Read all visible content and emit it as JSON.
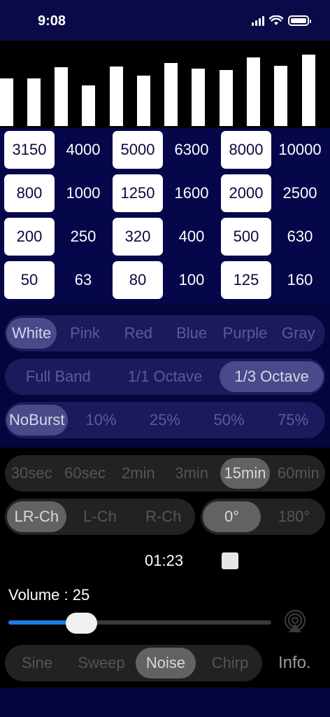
{
  "status_bar": {
    "time": "9:08"
  },
  "spectrum": {
    "levels": [
      0.57,
      0.57,
      0.7,
      0.48,
      0.71,
      0.6,
      0.75,
      0.68,
      0.67,
      0.82,
      0.72,
      0.85
    ]
  },
  "frequency_rows": [
    [
      {
        "label": "3150",
        "selected": true
      },
      {
        "label": "4000",
        "selected": false
      },
      {
        "label": "5000",
        "selected": true
      },
      {
        "label": "6300",
        "selected": false
      },
      {
        "label": "8000",
        "selected": true
      },
      {
        "label": "10000",
        "selected": false
      }
    ],
    [
      {
        "label": "800",
        "selected": true
      },
      {
        "label": "1000",
        "selected": false
      },
      {
        "label": "1250",
        "selected": true
      },
      {
        "label": "1600",
        "selected": false
      },
      {
        "label": "2000",
        "selected": true
      },
      {
        "label": "2500",
        "selected": false
      }
    ],
    [
      {
        "label": "200",
        "selected": true
      },
      {
        "label": "250",
        "selected": false
      },
      {
        "label": "320",
        "selected": true
      },
      {
        "label": "400",
        "selected": false
      },
      {
        "label": "500",
        "selected": true
      },
      {
        "label": "630",
        "selected": false
      }
    ],
    [
      {
        "label": "50",
        "selected": true
      },
      {
        "label": "63",
        "selected": false
      },
      {
        "label": "80",
        "selected": true
      },
      {
        "label": "100",
        "selected": false
      },
      {
        "label": "125",
        "selected": true
      },
      {
        "label": "160",
        "selected": false
      }
    ]
  ],
  "noise_color": {
    "options": [
      "White",
      "Pink",
      "Red",
      "Blue",
      "Purple",
      "Gray"
    ],
    "selected": 0
  },
  "band": {
    "options": [
      "Full Band",
      "1/1 Octave",
      "1/3 Octave"
    ],
    "selected": 2
  },
  "burst": {
    "options": [
      "NoBurst",
      "10%",
      "25%",
      "50%",
      "75%"
    ],
    "selected": 0
  },
  "duration": {
    "options": [
      "30sec",
      "60sec",
      "2min",
      "3min",
      "15min",
      "60min"
    ],
    "selected": 4
  },
  "channel": {
    "options": [
      "LR-Ch",
      "L-Ch",
      "R-Ch"
    ],
    "selected": 0
  },
  "phase": {
    "options": [
      "0°",
      "180°"
    ],
    "selected": 0
  },
  "timer": {
    "elapsed": "01:23"
  },
  "volume": {
    "label": "Volume : 25",
    "level": 0.25
  },
  "mode": {
    "options": [
      "Sine",
      "Sweep",
      "Noise",
      "Chirp"
    ],
    "selected": 2
  },
  "info_label": "Info.",
  "colors": {
    "accent": "#1e7ce8",
    "navy": "#06064a",
    "segment_bg": "#1a1a5c"
  }
}
